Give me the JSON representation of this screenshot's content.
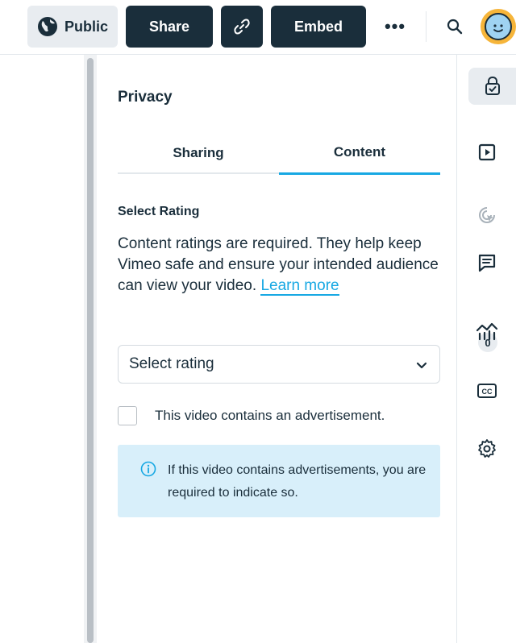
{
  "topbar": {
    "public_label": "Public",
    "share_label": "Share",
    "embed_label": "Embed",
    "more_label": "•••",
    "brand_dark": "#1a2e3b",
    "accent": "#17a8e3"
  },
  "panel": {
    "title": "Privacy",
    "tabs": [
      {
        "label": "Sharing",
        "active": false
      },
      {
        "label": "Content",
        "active": true
      }
    ],
    "section_title": "Select Rating",
    "description": "Content ratings are required. They help keep Vimeo safe and ensure your intended audience can view your video.",
    "learn_more": "Learn more",
    "select": {
      "value": "Select rating"
    },
    "ad_checkbox": {
      "label": "This video contains an advertisement.",
      "checked": false
    },
    "notice": "If this video contains advertisements, you are required to indicate so."
  },
  "rightbar": {
    "items": [
      {
        "icon": "lock-check-icon",
        "active": true
      },
      {
        "icon": "play-square-icon",
        "active": false
      },
      {
        "icon": "cursor-click-icon",
        "active": false
      },
      {
        "icon": "comment-icon",
        "active": false
      },
      {
        "icon": "analytics-icon",
        "active": false
      },
      {
        "icon": "cc-icon",
        "active": false
      },
      {
        "icon": "gear-icon",
        "active": false
      }
    ],
    "comment_count": "0"
  }
}
